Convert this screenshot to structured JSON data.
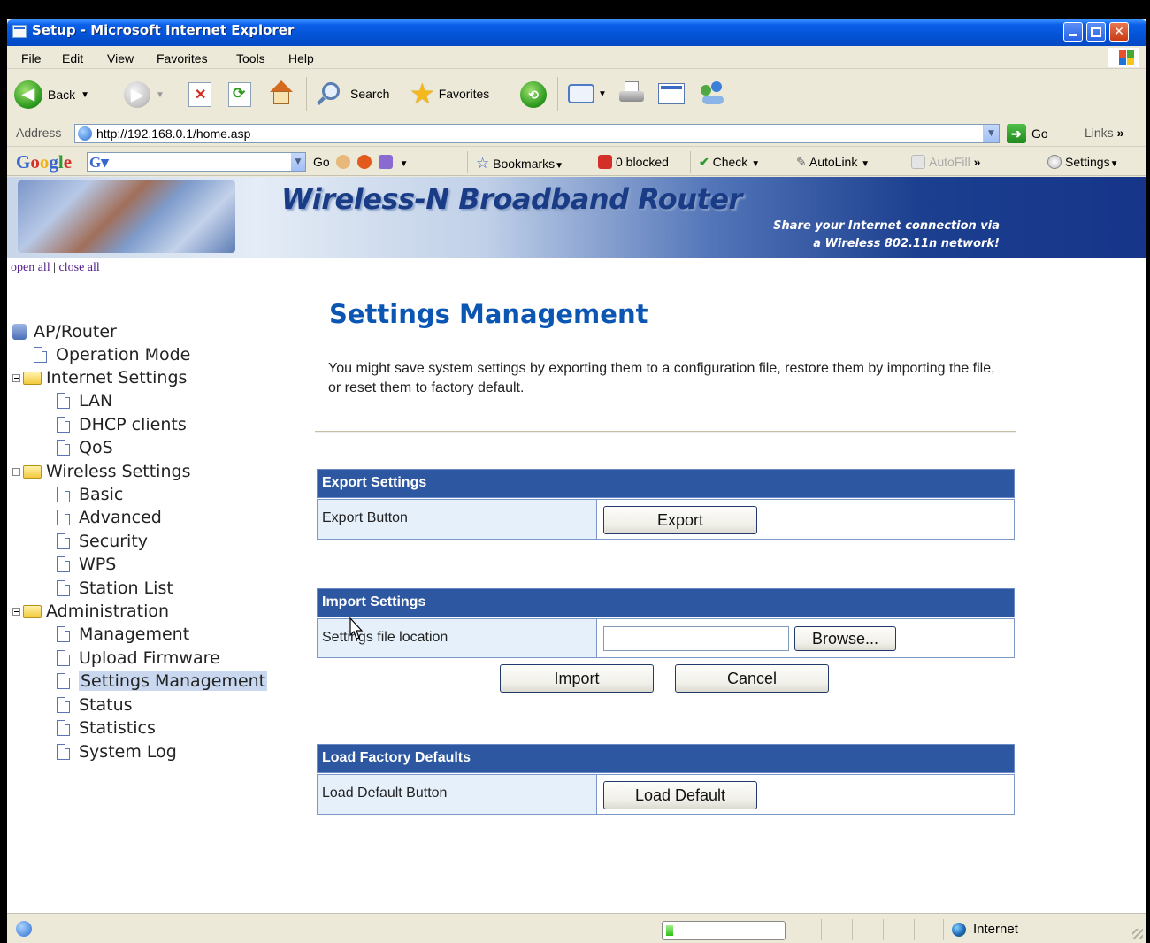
{
  "window": {
    "title": "Setup - Microsoft Internet Explorer",
    "controls": [
      "minimize",
      "maximize",
      "close"
    ]
  },
  "menubar": [
    "File",
    "Edit",
    "View",
    "Favorites",
    "Tools",
    "Help"
  ],
  "toolbar": {
    "back_label": "Back",
    "search_label": "Search",
    "favorites_label": "Favorites"
  },
  "address": {
    "label": "Address",
    "url": "http://192.168.0.1/home.asp",
    "go_label": "Go",
    "links_label": "Links"
  },
  "google_bar": {
    "logo": "Google",
    "go_label": "Go",
    "bookmarks_label": "Bookmarks",
    "blocked_label": "0 blocked",
    "check_label": "Check",
    "autolink_label": "AutoLink",
    "autofill_label": "AutoFill",
    "settings_label": "Settings"
  },
  "banner": {
    "title": "Wireless-N Broadband Router",
    "subtitle_line1": "Share your Internet connection via",
    "subtitle_line2": "a Wireless 802.11n network!"
  },
  "tree": {
    "open_all": "open all",
    "close_all": "close all",
    "root": "AP/Router",
    "items": [
      {
        "label": "Operation Mode",
        "type": "page",
        "level": 1
      },
      {
        "label": "Internet Settings",
        "type": "folder",
        "level": 1
      },
      {
        "label": "LAN",
        "type": "page",
        "level": 2
      },
      {
        "label": "DHCP clients",
        "type": "page",
        "level": 2
      },
      {
        "label": "QoS",
        "type": "page",
        "level": 2
      },
      {
        "label": "Wireless Settings",
        "type": "folder",
        "level": 1
      },
      {
        "label": "Basic",
        "type": "page",
        "level": 2
      },
      {
        "label": "Advanced",
        "type": "page",
        "level": 2
      },
      {
        "label": "Security",
        "type": "page",
        "level": 2
      },
      {
        "label": "WPS",
        "type": "page",
        "level": 2
      },
      {
        "label": "Station List",
        "type": "page",
        "level": 2
      },
      {
        "label": "Administration",
        "type": "folder",
        "level": 1
      },
      {
        "label": "Management",
        "type": "page",
        "level": 2
      },
      {
        "label": "Upload Firmware",
        "type": "page",
        "level": 2
      },
      {
        "label": "Settings Management",
        "type": "page",
        "level": 2,
        "selected": true
      },
      {
        "label": "Status",
        "type": "page",
        "level": 2
      },
      {
        "label": "Statistics",
        "type": "page",
        "level": 2
      },
      {
        "label": "System Log",
        "type": "page",
        "level": 2
      }
    ]
  },
  "main": {
    "title": "Settings Management",
    "intro": "You might save system settings by exporting them to a configuration file, restore them by importing the file, or reset them to factory default.",
    "export": {
      "header": "Export Settings",
      "row_label": "Export Button",
      "button": "Export"
    },
    "import": {
      "header": "Import Settings",
      "row_label": "Settings file location",
      "file_value": "",
      "browse_button": "Browse...",
      "import_button": "Import",
      "cancel_button": "Cancel"
    },
    "factory": {
      "header": "Load Factory Defaults",
      "row_label": "Load Default Button",
      "button": "Load Default"
    }
  },
  "statusbar": {
    "zone": "Internet",
    "progress_fraction": 0.06
  },
  "colors": {
    "titlebar": "#0453d6",
    "section_header": "#2d58a1",
    "row_label_bg": "#e6f0fb",
    "page_title": "#0b56b3"
  }
}
